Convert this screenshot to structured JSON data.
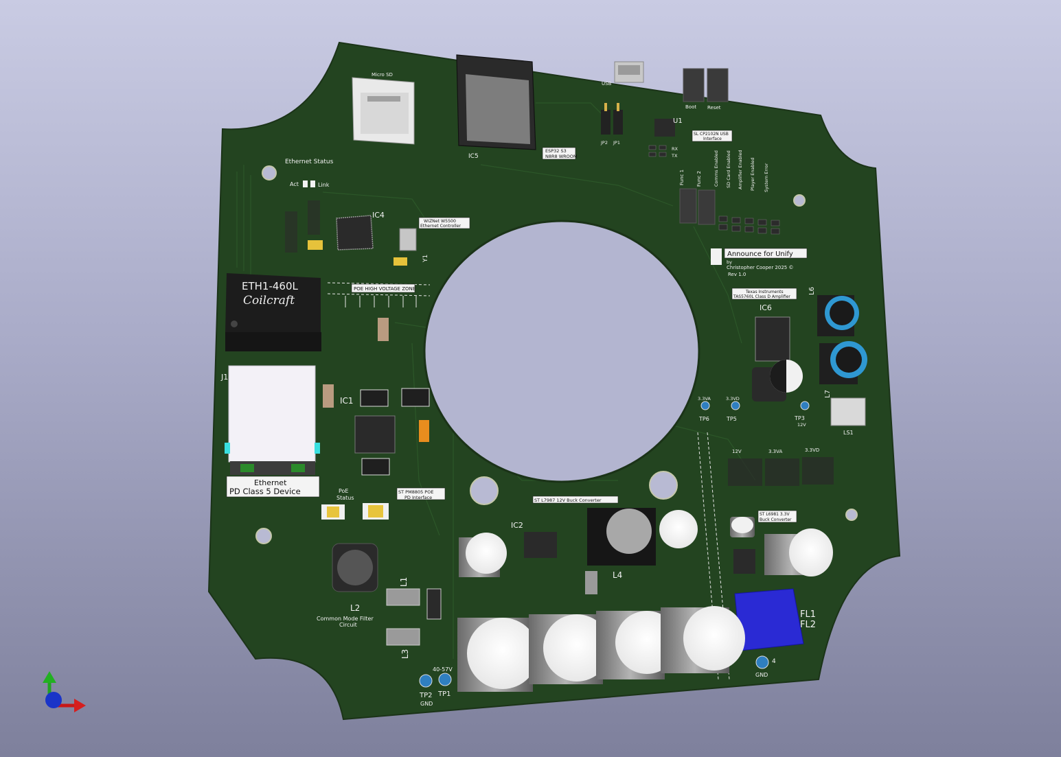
{
  "viewer": {
    "board_color": "#234420",
    "background_top": "#c9cbe3",
    "background_bottom": "#7e809c",
    "axis_icons": [
      "y-axis-green",
      "z-axis-blue",
      "x-axis-red"
    ]
  },
  "board": {
    "brand": {
      "title": "Announce for Unify",
      "by": "by",
      "author": "Christopher Cooper 2025 ©",
      "rev": "Rev 1.0"
    },
    "labels": {
      "micro_sd": "Micro SD",
      "ethernet_status": "Ethernet Status",
      "act": "Act",
      "link": "Link",
      "ic4": "IC4",
      "wiznet": [
        "WIZNet W5500",
        "Ethernet Controller"
      ],
      "y1": "Y1",
      "ic5": "IC5",
      "esp32": [
        "ESP32 S3",
        "N8R8 WROOM"
      ],
      "usb": "USB",
      "jp2": "JP2",
      "jp1": "JP1",
      "u1": "U1",
      "cp2102": [
        "SL CP2102N USB",
        "Interface"
      ],
      "rx": "RX",
      "tx": "TX",
      "boot": "Boot",
      "reset": "Reset",
      "func1": "Func 1",
      "func2": "Func 2",
      "leds": [
        "Comms Enabled",
        "SD Card Enabled",
        "Amplifier Enabled",
        "Player Enabled",
        "System Error"
      ],
      "poe_hv_zone": "POE HIGH VOLTAGE ZONE",
      "ic6": "IC6",
      "ti_amp": [
        "Texas Instruments",
        "TAS5760L Class D Amplifier"
      ],
      "l6": "L6",
      "l7": "L7",
      "ls1": "LS1",
      "ic1": "IC1",
      "j1": "J1",
      "ethernet": [
        "Ethernet",
        "PD Class 5 Device"
      ],
      "poe_status": [
        "PoE",
        "Status"
      ],
      "st_pm8805": [
        "ST PM8805 POE",
        "PD Interface"
      ],
      "ic2": "IC2",
      "st_l7987": "ST L7987 12V Buck Converter",
      "l4": "L4",
      "st_l6981": [
        "ST L6981 3.3V",
        "Buck Converter"
      ],
      "fl1": "FL1",
      "fl2": "FL2",
      "l1": "L1",
      "l2": "L2",
      "l3": "L3",
      "cm_filter": [
        "Common Mode Filter",
        "Circuit"
      ],
      "tp6": "TP6",
      "tp5": "TP5",
      "tp3": "TP3",
      "tp6_v": "3.3VA",
      "tp5_v": "3.3VD",
      "tp3_v": "12V",
      "rail_12v": "12V",
      "rail_33va": "3.3VA",
      "rail_33vd": "3.3VD",
      "tp1": "TP1",
      "tp2": "TP2",
      "tp1_v": "40-57V",
      "tp2_v": "GND",
      "tp4": "4",
      "gnd": "GND",
      "eth_module_top": "ETH1-460L",
      "eth_module_brand": "Coilcraft"
    }
  }
}
